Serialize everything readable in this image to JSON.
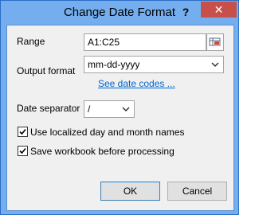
{
  "window": {
    "title": "Change Date Format",
    "help_label": "?",
    "close_label": "✕"
  },
  "form": {
    "range_label": "Range",
    "range_value": "A1:C25",
    "output_format_label": "Output format",
    "output_format_value": "mm-dd-yyyy",
    "date_codes_link": "See date codes ...",
    "date_separator_label": "Date separator",
    "date_separator_value": "/",
    "localized_names_label": "Use localized day and month names",
    "localized_names_checked": true,
    "save_workbook_label": "Save workbook before processing",
    "save_workbook_checked": true
  },
  "buttons": {
    "ok": "OK",
    "cancel": "Cancel"
  },
  "icons": {
    "range_picker": "range-select-icon",
    "dropdown": "chevron-down-icon",
    "check": "checkmark-icon"
  }
}
